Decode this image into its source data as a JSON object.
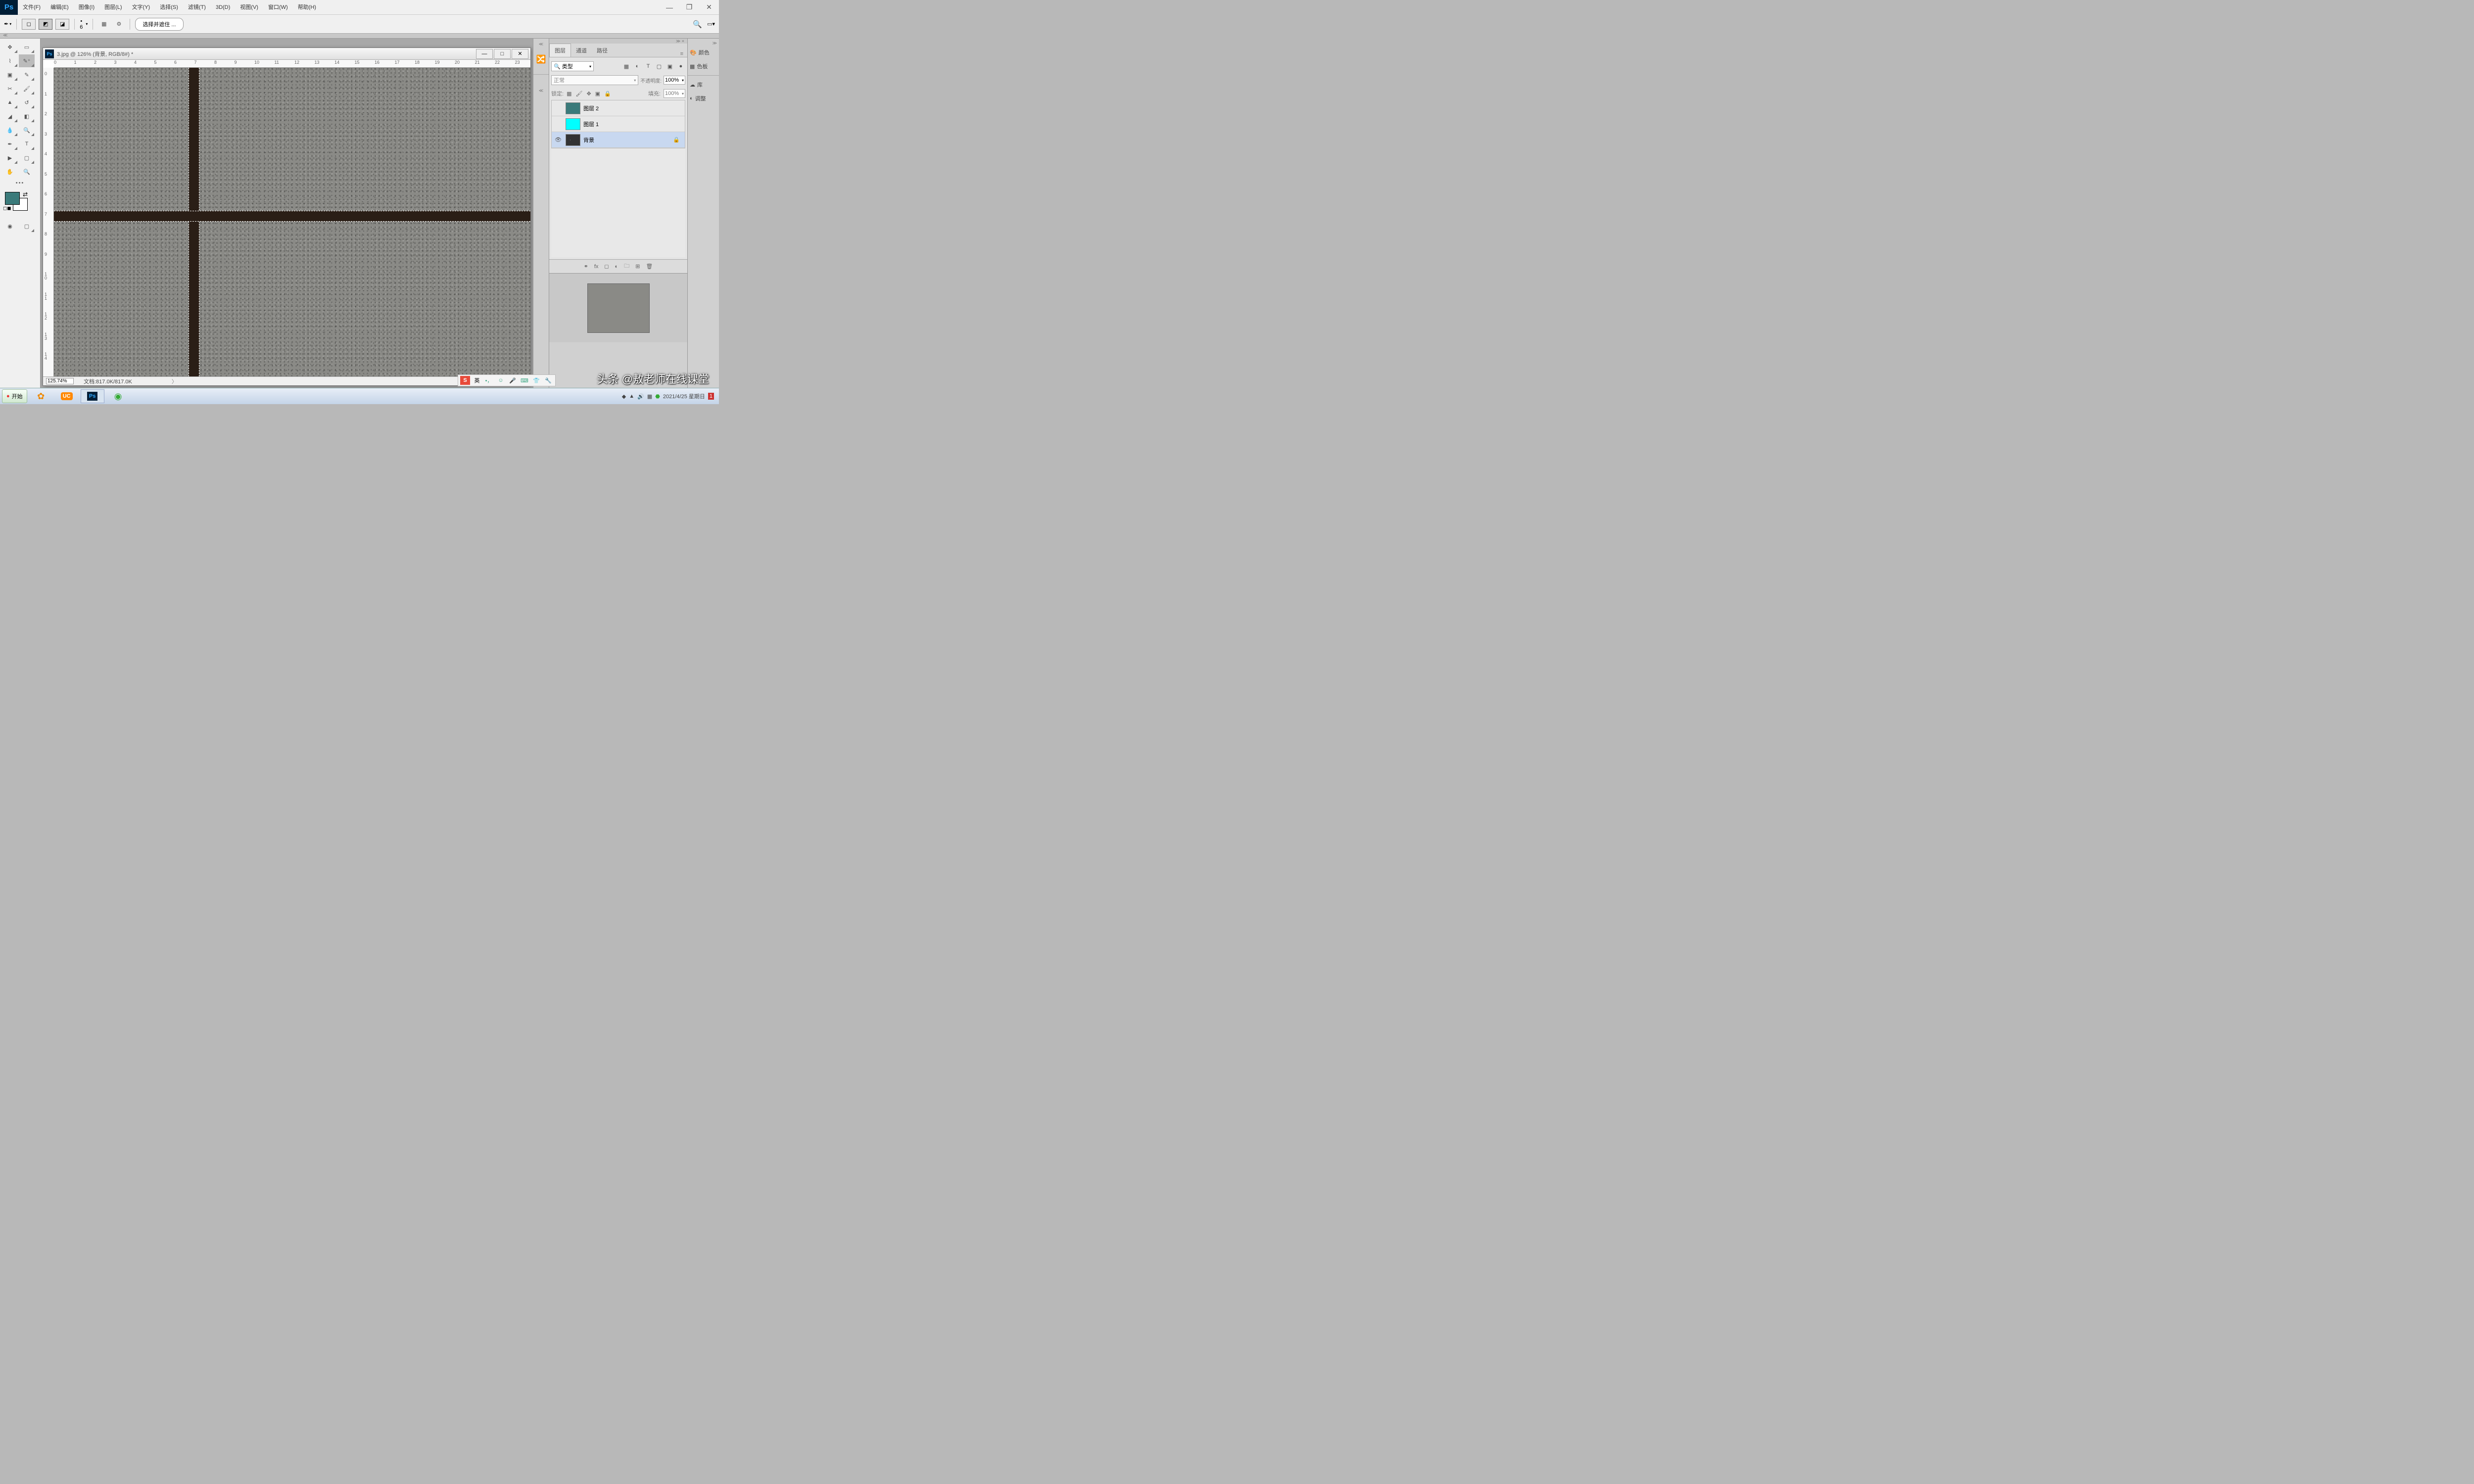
{
  "menubar": {
    "items": [
      "文件(F)",
      "编辑(E)",
      "图像(I)",
      "图层(L)",
      "文字(Y)",
      "选择(S)",
      "滤镜(T)",
      "3D(D)",
      "视图(V)",
      "窗口(W)",
      "帮助(H)"
    ]
  },
  "options": {
    "brush_size": "6",
    "button": "选择并遮住 ..."
  },
  "doc": {
    "title": "3.jpg @ 126% (背景, RGB/8#) *"
  },
  "ruler_h": [
    "0",
    "1",
    "2",
    "3",
    "4",
    "5",
    "6",
    "7",
    "8",
    "9",
    "10",
    "11",
    "12",
    "13",
    "14",
    "15",
    "16",
    "17",
    "18",
    "19",
    "20",
    "21",
    "22",
    "23"
  ],
  "ruler_v": [
    "0",
    "1",
    "2",
    "3",
    "4",
    "5",
    "6",
    "7",
    "8",
    "9",
    "10",
    "11",
    "12",
    "13",
    "14"
  ],
  "status": {
    "zoom": "125.74%",
    "doc": "文档:817.0K/817.0K"
  },
  "panels": {
    "tabs": [
      "图层",
      "通道",
      "路径"
    ],
    "filter_label": "类型",
    "blend_mode": "正常",
    "opacity_label": "不透明度:",
    "opacity": "100%",
    "lock_label": "锁定:",
    "fill_label": "填充:",
    "fill": "100%",
    "layers": [
      {
        "name": "图层 2",
        "color": "#3a7a7a",
        "eye": ""
      },
      {
        "name": "图层 1",
        "color": "#00ffff",
        "eye": ""
      },
      {
        "name": "背景",
        "color": "#888",
        "eye": "👁",
        "locked": true
      }
    ]
  },
  "side": {
    "items": [
      "颜色",
      "色板",
      "库",
      "调整"
    ]
  },
  "taskbar": {
    "start": "开始",
    "datetime": "2021/4/25 星期日"
  },
  "watermark": "头条 @敖老师在线课堂",
  "ime": {
    "lang": "英"
  }
}
